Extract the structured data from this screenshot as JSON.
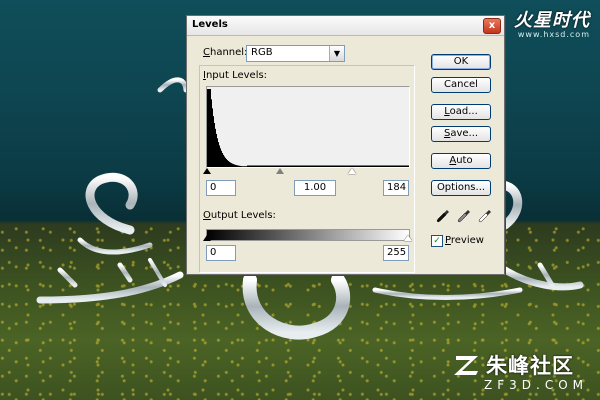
{
  "dialog": {
    "title": "Levels",
    "close_glyph": "x",
    "channel": {
      "label_u": "C",
      "label_rest": "hannel:",
      "value": "RGB"
    },
    "input_levels": {
      "label_u": "I",
      "label_rest": "nput Levels:",
      "black": "0",
      "gamma": "1.00",
      "white": "184"
    },
    "output_levels": {
      "label_u": "O",
      "label_rest": "utput Levels:",
      "black": "0",
      "white": "255"
    },
    "buttons": {
      "ok": "OK",
      "cancel": "Cancel",
      "load_u": "L",
      "load_rest": "oad...",
      "save_u": "S",
      "save_rest": "ave...",
      "auto_u": "A",
      "auto_rest": "uto",
      "options_u": "T",
      "options_rest": "Options...",
      "options": "Options..."
    },
    "preview": {
      "label_u": "P",
      "label_rest": "review",
      "checked": true,
      "check_glyph": "✓"
    },
    "eyedroppers": [
      "eyedropper-black-icon",
      "eyedropper-gray-icon",
      "eyedropper-white-icon"
    ]
  },
  "watermarks": {
    "top_brand": "火星时代",
    "top_url": "www.hxsd.com",
    "bottom_brand": "朱峰社区",
    "bottom_url": "ZF3D.COM"
  },
  "colors": {
    "dialog_bg": "#ece9d8",
    "close": "#c2371b",
    "focus_border": "#003c74"
  }
}
